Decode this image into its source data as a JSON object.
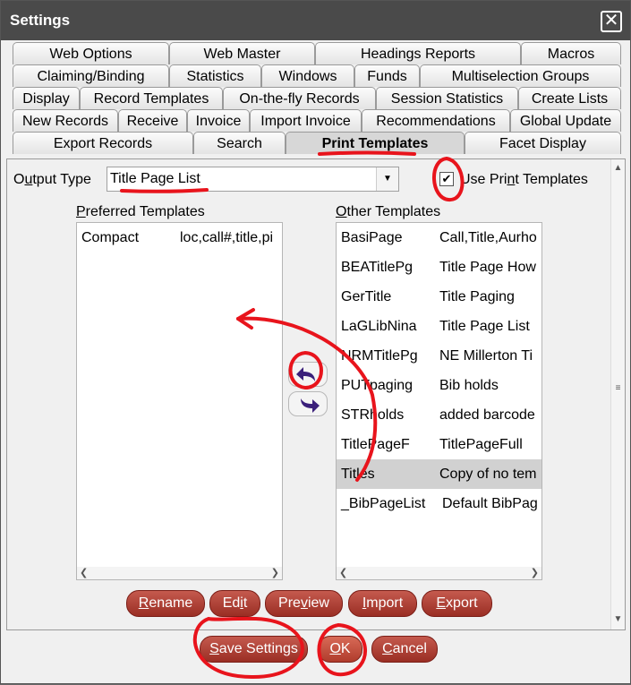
{
  "window": {
    "title": "Settings",
    "close_glyph": "✕"
  },
  "tabs": {
    "row1": [
      "Web Options",
      "Web Master",
      "Headings Reports",
      "Macros"
    ],
    "row2": [
      "Claiming/Binding",
      "Statistics",
      "Windows",
      "Funds",
      "Multiselection Groups"
    ],
    "row3": [
      "Display",
      "Record Templates",
      "On-the-fly Records",
      "Session Statistics",
      "Create Lists"
    ],
    "row4": [
      "New Records",
      "Receive",
      "Invoice",
      "Import Invoice",
      "Recommendations",
      "Global Update"
    ],
    "row5": [
      "Export Records",
      "Search",
      "Print Templates",
      "Facet Display"
    ],
    "active": "Print Templates"
  },
  "output_type": {
    "label_pre": "O",
    "label_u": "u",
    "label_post": "tput Type",
    "value": "Title Page List"
  },
  "use_print_templates": {
    "label_pre": "Use Pri",
    "label_u": "n",
    "label_post": "t Templates",
    "checked": true,
    "check_glyph": "✔"
  },
  "preferred": {
    "label_u": "P",
    "label_rest": "referred Templates",
    "rows": [
      {
        "name": "Compact",
        "desc": "loc,call#,title,pi"
      }
    ]
  },
  "other": {
    "label_u": "O",
    "label_rest": "ther Templates",
    "rows": [
      {
        "name": "BasiPage",
        "desc": "Call,Title,Aurho"
      },
      {
        "name": "BEATitlePg",
        "desc": "Title Page How"
      },
      {
        "name": "GerTitle",
        "desc": "Title Paging"
      },
      {
        "name": "LaGLibNina",
        "desc": "Title Page List"
      },
      {
        "name": "NRMTitlePg",
        "desc": "NE Millerton Ti"
      },
      {
        "name": "PUTpaging",
        "desc": "Bib holds"
      },
      {
        "name": "STRholds",
        "desc": "added barcode"
      },
      {
        "name": "TitlePageF",
        "desc": "TitlePageFull"
      },
      {
        "name": "Titles",
        "desc": "Copy of no tem"
      },
      {
        "name": "_BibPageList",
        "desc": "Default BibPag"
      }
    ],
    "selected": "Titles"
  },
  "actions": [
    {
      "u": "R",
      "rest": "ename"
    },
    {
      "u": "",
      "pre": "Ed",
      "mid": "i",
      "rest": "t"
    },
    {
      "u": "",
      "pre": "Pre",
      "mid": "v",
      "rest": "iew"
    },
    {
      "u": "I",
      "rest": "mport"
    },
    {
      "u": "E",
      "rest": "xport"
    }
  ],
  "footer": {
    "save": {
      "u": "S",
      "rest": "ave Settings"
    },
    "ok": {
      "u": "O",
      "rest": "K"
    },
    "cancel": {
      "u": "C",
      "rest": "ancel"
    }
  },
  "icons": {
    "scroll_up": "▲",
    "scroll_down": "▼",
    "scroll_left": "❮",
    "scroll_right": "❯",
    "dropdown": "▼"
  },
  "colors": {
    "button": "#b0463b",
    "annotation": "#e8141c",
    "arrow_icon": "#3a1f7a"
  }
}
